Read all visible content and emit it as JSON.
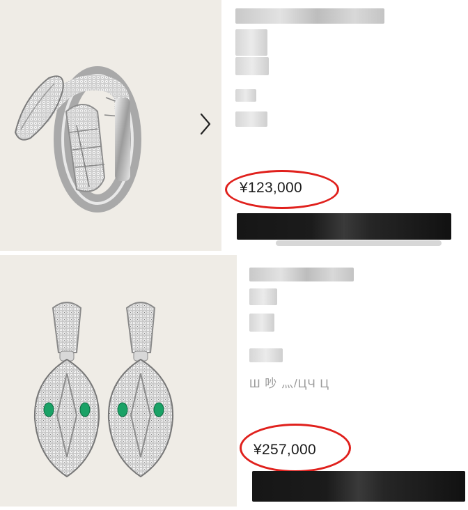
{
  "products": [
    {
      "image_icon": "serpent-ring-image",
      "next_icon": "chevron-right-icon",
      "price": "¥123,000"
    },
    {
      "image_icon": "serpent-earrings-image",
      "price": "¥257,000",
      "partial_text": "Ш  吵  灬/ЦЧ  Ц"
    }
  ],
  "colors": {
    "highlight_ring": "#e0201c",
    "image_background": "#efece6",
    "emerald": "#1aa266"
  }
}
